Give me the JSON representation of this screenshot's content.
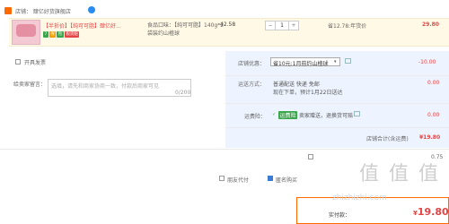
{
  "store": {
    "label": "店铺：  肆亿好货旗舰店",
    "icon": "store-icon",
    "chat_icon": "wangwang-chat-icon"
  },
  "item": {
    "title_tag": "【半折价】【纯可可脂】肆亿好...",
    "badges": [
      "7",
      "保",
      "险",
      "假货赔"
    ],
    "sku_flavor": "食品口味：【纯可可脂】140g*2",
    "sku_spec": "袋装约山楂球",
    "unit_price": "42.58",
    "quantity": "1",
    "qty_minus": "−",
    "qty_plus": "+",
    "discount": "省12.78:年货价",
    "total": "29.80"
  },
  "invoice": {
    "label": "开具发票"
  },
  "remark": {
    "label": "给卖家留言：",
    "placeholder": "选填，请先和商家协商一致，付款后商家可见",
    "count": "0/200"
  },
  "coupon": {
    "label": "店铺优惠：",
    "selected": "省10元:1月前约山楂球",
    "amount": "-10.00"
  },
  "shipping": {
    "label": "运送方式：",
    "line1": "普通配送 快递 免邮",
    "line2": "现在下单，预计1月22日送达",
    "amount": "0.00"
  },
  "insurance": {
    "label": "运费险：",
    "tag": "运费险",
    "text": "卖家赠送，退换货可赔",
    "amount": "0.00"
  },
  "subtotal": {
    "label": "店铺合计(含运费)",
    "amount": "¥19.80"
  },
  "options": {
    "anon": "匿名购买",
    "friend": "朋友代付",
    "right_value": "0.75"
  },
  "payment": {
    "label": "实付款：",
    "currency": "¥",
    "amount": "19.80"
  },
  "watermark": {
    "big": "值 值 值",
    "small": "zhizhizhi.com"
  }
}
